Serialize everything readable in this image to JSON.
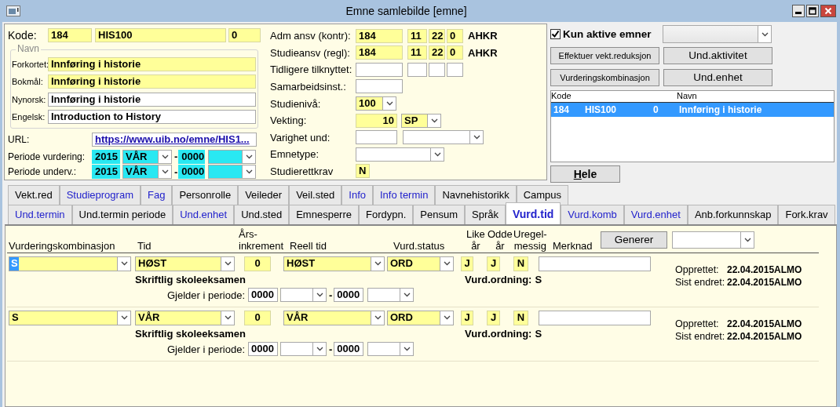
{
  "window": {
    "title": "Emne samlebilde  [emne]"
  },
  "kode": {
    "label": "Kode:",
    "fields": [
      {
        "kind": "text",
        "mandatory": true,
        "value": "184"
      },
      {
        "kind": "text",
        "mandatory": true,
        "value": "HIS100"
      },
      {
        "kind": "text",
        "mandatory": true,
        "value": "0"
      }
    ]
  },
  "navn": {
    "legend": "Navn",
    "rows": [
      {
        "label": "Forkortet:",
        "field": {
          "kind": "text",
          "mandatory": true,
          "value": "Innføring i historie"
        }
      },
      {
        "label": "Bokmål:",
        "field": {
          "kind": "text",
          "mandatory": true,
          "value": "Innføring i historie"
        }
      },
      {
        "label": "Nynorsk:",
        "field": {
          "kind": "text",
          "mandatory": false,
          "value": "Innføring i historie"
        }
      },
      {
        "label": "Engelsk:",
        "field": {
          "kind": "text",
          "mandatory": false,
          "value": "Introduction to History"
        }
      }
    ]
  },
  "url": {
    "label": "URL:",
    "field": {
      "kind": "link",
      "value": "https://www.uib.no/emne/HIS1..."
    }
  },
  "perioder": [
    {
      "label": "Periode vurdering:",
      "fields": [
        {
          "kind": "text",
          "period": true,
          "value": "2015"
        },
        {
          "kind": "combo",
          "period": true,
          "value": "VÅR"
        },
        {
          "kind": "dash",
          "value": "-"
        },
        {
          "kind": "text",
          "period": true,
          "value": "0000"
        },
        {
          "kind": "combo",
          "period": true
        }
      ]
    },
    {
      "label": "Periode underv.:",
      "fields": [
        {
          "kind": "text",
          "period": true,
          "value": "2015"
        },
        {
          "kind": "combo",
          "period": true,
          "value": "VÅR"
        },
        {
          "kind": "dash",
          "value": "-"
        },
        {
          "kind": "text",
          "period": true,
          "value": "0000"
        },
        {
          "kind": "combo",
          "period": true
        }
      ]
    }
  ],
  "ansvar": [
    {
      "label": "Adm ansv (kontr):",
      "fields": [
        {
          "kind": "text",
          "mandatory": true,
          "value": "184"
        },
        {
          "kind": "text",
          "mandatory": true,
          "value": "11"
        },
        {
          "kind": "text",
          "mandatory": true,
          "value": "22"
        },
        {
          "kind": "text",
          "mandatory": true,
          "value": "0"
        },
        {
          "kind": "code",
          "value": "AHKR"
        }
      ]
    },
    {
      "label": "Studieansv (regl):",
      "fields": [
        {
          "kind": "text",
          "mandatory": true,
          "value": "184"
        },
        {
          "kind": "text",
          "mandatory": true,
          "value": "11"
        },
        {
          "kind": "text",
          "mandatory": true,
          "value": "22"
        },
        {
          "kind": "text",
          "mandatory": true,
          "value": "0"
        },
        {
          "kind": "code",
          "value": "AHKR"
        }
      ]
    },
    {
      "label": "Tidligere tilknyttet:",
      "fields": [
        {
          "kind": "text",
          "mandatory": false
        },
        {
          "kind": "text",
          "mandatory": false
        },
        {
          "kind": "text",
          "mandatory": false
        },
        {
          "kind": "text",
          "mandatory": false
        }
      ]
    },
    {
      "label": "Samarbeidsinst.:",
      "fields": [
        {
          "kind": "text",
          "mandatory": false
        }
      ]
    },
    {
      "label": "Studienivå:",
      "fields": [
        {
          "kind": "combo",
          "mandatory": true,
          "value": "100"
        }
      ]
    },
    {
      "label": "Vekting:",
      "fields": [
        {
          "kind": "number",
          "mandatory": true,
          "value": "10"
        },
        {
          "kind": "combo",
          "mandatory": true,
          "value": "SP"
        }
      ]
    },
    {
      "label": "Varighet und:",
      "fields": [
        {
          "kind": "text",
          "mandatory": false
        },
        {
          "kind": "combo",
          "mandatory": false
        }
      ]
    },
    {
      "label": "Emnetype:",
      "fields": [
        {
          "kind": "combo",
          "mandatory": false
        }
      ]
    },
    {
      "label": "Studierettkrav",
      "fields": [
        {
          "kind": "text",
          "mandatory": true,
          "value": "N"
        }
      ]
    }
  ],
  "right": {
    "filter": {
      "label": "Kun aktive emner",
      "checked": true
    },
    "buttons": [
      "Effektuer vekt.reduksjon",
      "Und.aktivitet",
      "Vurderingskombinasjon",
      "Und.enhet"
    ],
    "list": {
      "columns": [
        "Kode",
        "",
        "",
        "Navn"
      ],
      "rows": [
        {
          "cells": [
            "184",
            "HIS100",
            "0",
            "Innføring i historie"
          ],
          "selected": true
        }
      ]
    },
    "hele_button": "Hele"
  },
  "tab_rows": [
    {
      "tabs": [
        {
          "label": "Vekt.red",
          "has_data": false,
          "selected": false
        },
        {
          "label": "Studieprogram",
          "has_data": true,
          "selected": false
        },
        {
          "label": "Fag",
          "has_data": true,
          "selected": false
        },
        {
          "label": "Personrolle",
          "has_data": false,
          "selected": false
        },
        {
          "label": "Veileder",
          "has_data": false,
          "selected": false
        },
        {
          "label": "Veil.sted",
          "has_data": false,
          "selected": false
        },
        {
          "label": "Info",
          "has_data": true,
          "selected": false
        },
        {
          "label": "Info termin",
          "has_data": true,
          "selected": false
        },
        {
          "label": "Navnehistorikk",
          "has_data": false,
          "selected": false
        },
        {
          "label": "Campus",
          "has_data": false,
          "selected": false
        }
      ]
    },
    {
      "tabs": [
        {
          "label": "Und.termin",
          "has_data": true,
          "selected": false
        },
        {
          "label": "Und.termin periode",
          "has_data": false,
          "selected": false
        },
        {
          "label": "Und.enhet",
          "has_data": true,
          "selected": false
        },
        {
          "label": "Und.sted",
          "has_data": false,
          "selected": false
        },
        {
          "label": "Emnesperre",
          "has_data": false,
          "selected": false
        },
        {
          "label": "Fordypn.",
          "has_data": false,
          "selected": false
        },
        {
          "label": "Pensum",
          "has_data": false,
          "selected": false
        },
        {
          "label": "Språk",
          "has_data": false,
          "selected": false
        },
        {
          "label": "Vurd.tid",
          "has_data": true,
          "selected": true
        },
        {
          "label": "Vurd.komb",
          "has_data": true,
          "selected": false
        },
        {
          "label": "Vurd.enhet",
          "has_data": true,
          "selected": false
        },
        {
          "label": "Anb.forkunnskap",
          "has_data": false,
          "selected": false
        },
        {
          "label": "Fork.krav",
          "has_data": false,
          "selected": false
        }
      ]
    }
  ],
  "vurd_tid": {
    "columns": [
      "Vurderingskombinasjon",
      "Tid",
      "Års-\ninkrement",
      "Reell tid",
      "Vurd.status",
      "Like\når",
      "Odde\når",
      "Uregel-\nmessig",
      "Merknad"
    ],
    "generate_button": "Generer",
    "records": [
      {
        "fields": [
          {
            "kind": "combo",
            "mandatory": true,
            "value": "S",
            "focused": true
          },
          {
            "kind": "combo",
            "mandatory": true,
            "value": "HØST"
          },
          {
            "kind": "text",
            "mandatory": true,
            "value": "0"
          },
          {
            "kind": "combo",
            "mandatory": true,
            "value": "HØST"
          },
          {
            "kind": "combo",
            "mandatory": true,
            "value": "ORD"
          },
          {
            "kind": "text",
            "mandatory": true,
            "value": "J"
          },
          {
            "kind": "text",
            "mandatory": true,
            "value": "J"
          },
          {
            "kind": "text",
            "mandatory": true,
            "value": "N"
          },
          {
            "kind": "text",
            "mandatory": false
          }
        ],
        "description": "Skriftlig skoleeksamen",
        "ordning_label": "Vurd.ordning:",
        "ordning": "S",
        "created_label": "Opprettet:",
        "created": "22.04.2015",
        "created_by": "ALMO",
        "changed_label": "Sist endret:",
        "changed": "22.04.2015",
        "changed_by": "ALMO",
        "period_label": "Gjelder i periode:",
        "period": [
          {
            "kind": "text",
            "mandatory": false,
            "value": "0000"
          },
          {
            "kind": "combo",
            "mandatory": false
          },
          {
            "kind": "dash",
            "value": "-"
          },
          {
            "kind": "text",
            "mandatory": false,
            "value": "0000"
          },
          {
            "kind": "combo",
            "mandatory": false
          }
        ]
      },
      {
        "fields": [
          {
            "kind": "combo",
            "mandatory": true,
            "value": "S",
            "focused": false
          },
          {
            "kind": "combo",
            "mandatory": true,
            "value": "VÅR"
          },
          {
            "kind": "text",
            "mandatory": true,
            "value": "0"
          },
          {
            "kind": "combo",
            "mandatory": true,
            "value": "VÅR"
          },
          {
            "kind": "combo",
            "mandatory": true,
            "value": "ORD"
          },
          {
            "kind": "text",
            "mandatory": true,
            "value": "J"
          },
          {
            "kind": "text",
            "mandatory": true,
            "value": "J"
          },
          {
            "kind": "text",
            "mandatory": true,
            "value": "N"
          },
          {
            "kind": "text",
            "mandatory": false
          }
        ],
        "description": "Skriftlig skoleeksamen",
        "ordning_label": "Vurd.ordning:",
        "ordning": "S",
        "created_label": "Opprettet:",
        "created": "22.04.2015",
        "created_by": "ALMO",
        "changed_label": "Sist endret:",
        "changed": "22.04.2015",
        "changed_by": "ALMO",
        "period_label": "Gjelder i periode:",
        "period": [
          {
            "kind": "text",
            "mandatory": false,
            "value": "0000"
          },
          {
            "kind": "combo",
            "mandatory": false
          },
          {
            "kind": "dash",
            "value": "-"
          },
          {
            "kind": "text",
            "mandatory": false,
            "value": "0000"
          },
          {
            "kind": "combo",
            "mandatory": false
          }
        ]
      }
    ]
  }
}
